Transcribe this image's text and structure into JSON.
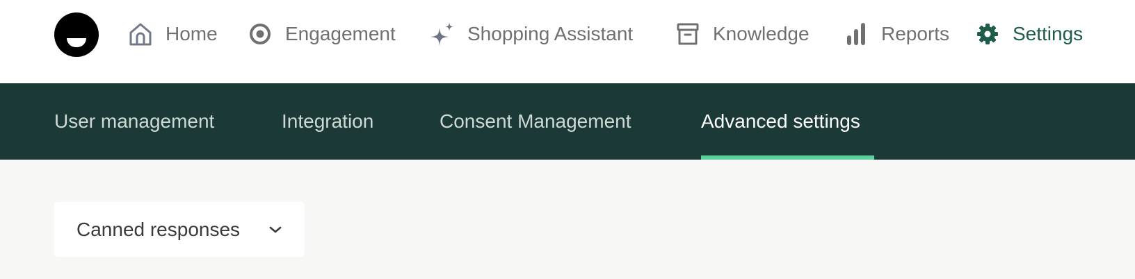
{
  "colors": {
    "nav_inactive": "#707070",
    "nav_active": "#1f5c4a",
    "subnav_bg": "#1b3a37",
    "subnav_text": "#cfd8d5",
    "tab_active_underline": "#5ecf9a",
    "page_bg": "#f7f7f5"
  },
  "topnav": {
    "items": [
      {
        "label": "Home",
        "icon": "home-icon",
        "active": false
      },
      {
        "label": "Engagement",
        "icon": "target-icon",
        "active": false
      },
      {
        "label": "Shopping Assistant",
        "icon": "sparkle-icon",
        "active": false
      },
      {
        "label": "Knowledge",
        "icon": "archive-box-icon",
        "active": false
      },
      {
        "label": "Reports",
        "icon": "bar-chart-icon",
        "active": false
      },
      {
        "label": "Settings",
        "icon": "gear-icon",
        "active": true
      }
    ]
  },
  "subnav": {
    "tabs": [
      {
        "label": "User management",
        "active": false
      },
      {
        "label": "Integration",
        "active": false
      },
      {
        "label": "Consent Management",
        "active": false
      },
      {
        "label": "Advanced settings",
        "active": true
      }
    ]
  },
  "section_dropdown": {
    "selected": "Canned responses",
    "icon": "chevron-down-icon"
  }
}
